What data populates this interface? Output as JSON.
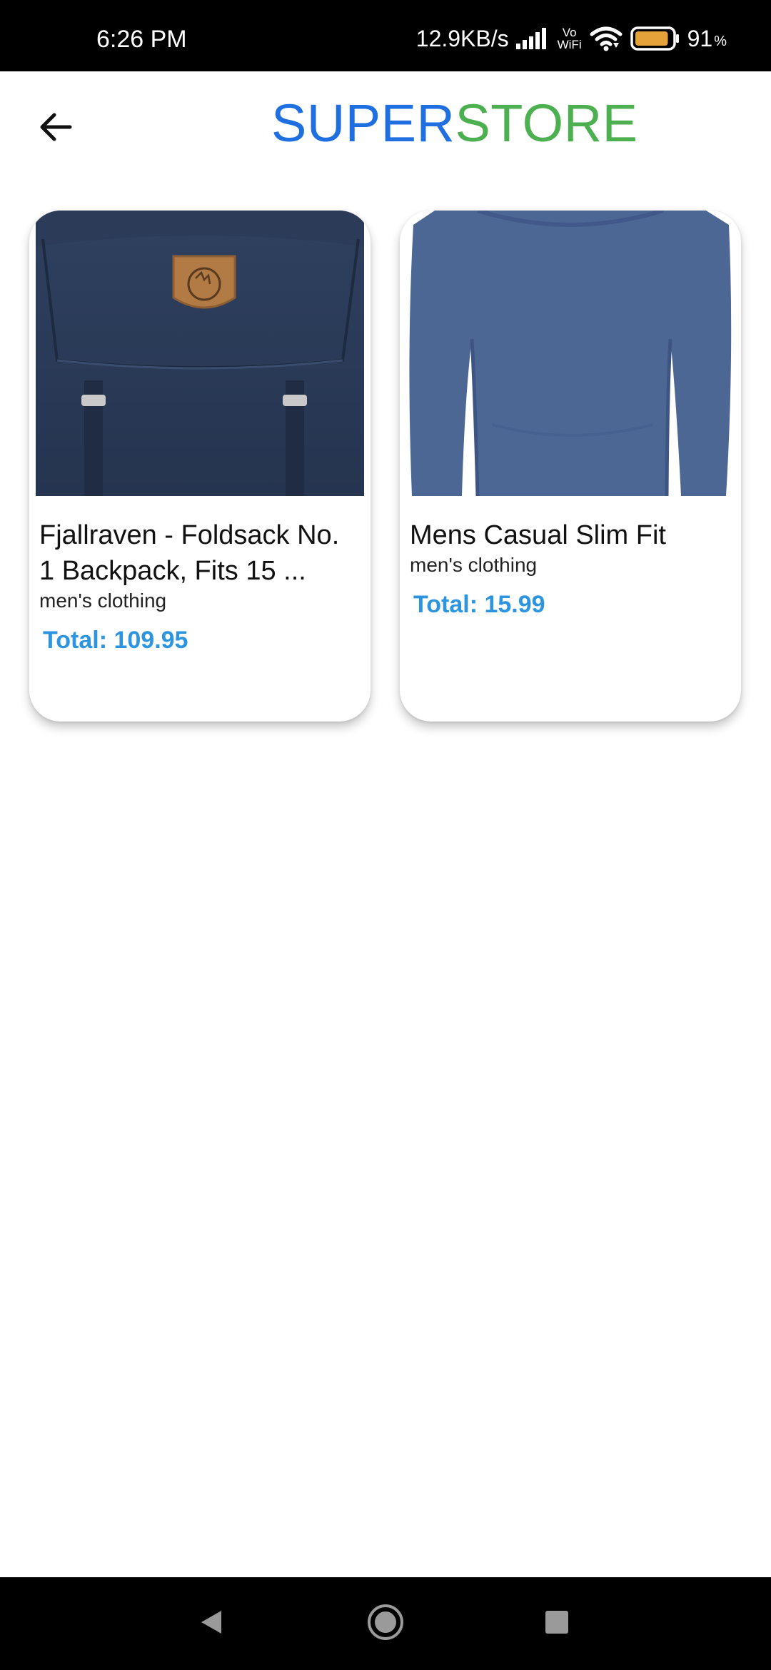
{
  "status_bar": {
    "time": "6:26 PM",
    "network_speed": "12.9KB/s",
    "volte_top": "Vo",
    "volte_bottom": "WiFi",
    "battery_value": "91",
    "battery_unit": "%",
    "battery_level": 0.91,
    "icons": [
      "signal-icon",
      "wifi-icon",
      "battery-icon"
    ]
  },
  "app_bar": {
    "back_icon": "arrow-left-icon",
    "title_part1": "SUPER",
    "title_part2": "STORE",
    "colors": {
      "title_part1": "#1f6fe0",
      "title_part2": "#4caf50"
    }
  },
  "products": [
    {
      "title": "Fjallraven - Foldsack No. 1 Backpack, Fits 15 ...",
      "title_line1": "Fjallraven - Foldsack No.",
      "title_line2": "1 Backpack, Fits 15 ...",
      "category": "men's clothing",
      "total": "Total: 109.95",
      "image": "navy-backpack"
    },
    {
      "title": "Mens Casual Slim Fit",
      "category": "men's clothing",
      "total": "Total: 15.99",
      "image": "blue-long-sleeve-shirt"
    }
  ],
  "accent_colors": {
    "total_text": "#2d95e0"
  },
  "nav_bar": {
    "icons": [
      "back-triangle-icon",
      "home-circle-icon",
      "recents-square-icon"
    ]
  }
}
